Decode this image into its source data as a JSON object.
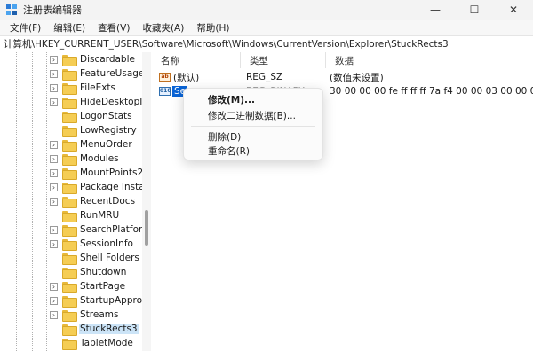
{
  "window": {
    "title": "注册表编辑器",
    "minimize_glyph": "—",
    "maximize_glyph": "☐",
    "close_glyph": "✕"
  },
  "menu": [
    "文件(F)",
    "编辑(E)",
    "查看(V)",
    "收藏夹(A)",
    "帮助(H)"
  ],
  "address": "计算机\\HKEY_CURRENT_USER\\Software\\Microsoft\\Windows\\CurrentVersion\\Explorer\\StuckRects3",
  "tree": {
    "items": [
      "Discardable",
      "FeatureUsage",
      "FileExts",
      "HideDesktopIco",
      "LogonStats",
      "LowRegistry",
      "MenuOrder",
      "Modules",
      "MountPoints2",
      "Package Installa",
      "RecentDocs",
      "RunMRU",
      "SearchPlatform",
      "SessionInfo",
      "Shell Folders",
      "Shutdown",
      "StartPage",
      "StartupApprove",
      "Streams",
      "StuckRects3",
      "TabletMode"
    ],
    "expandable": [
      true,
      true,
      true,
      true,
      false,
      false,
      true,
      true,
      true,
      true,
      true,
      false,
      true,
      true,
      false,
      false,
      true,
      true,
      true,
      false,
      false
    ],
    "selected": "StuckRects3"
  },
  "list": {
    "columns": [
      "名称",
      "类型",
      "数据"
    ],
    "rows": [
      {
        "icon": "ab",
        "name": "(默认)",
        "type": "REG_SZ",
        "data": "(数值未设置)"
      },
      {
        "icon": "010",
        "name": "Se",
        "type": "REG_BINARY",
        "data": "30 00 00 00 fe ff ff ff 7a f4 00 00 03 00 00 00"
      }
    ]
  },
  "context_menu": {
    "items": [
      "修改(M)...",
      "修改二进制数据(B)...",
      "删除(D)",
      "重命名(R)"
    ]
  }
}
